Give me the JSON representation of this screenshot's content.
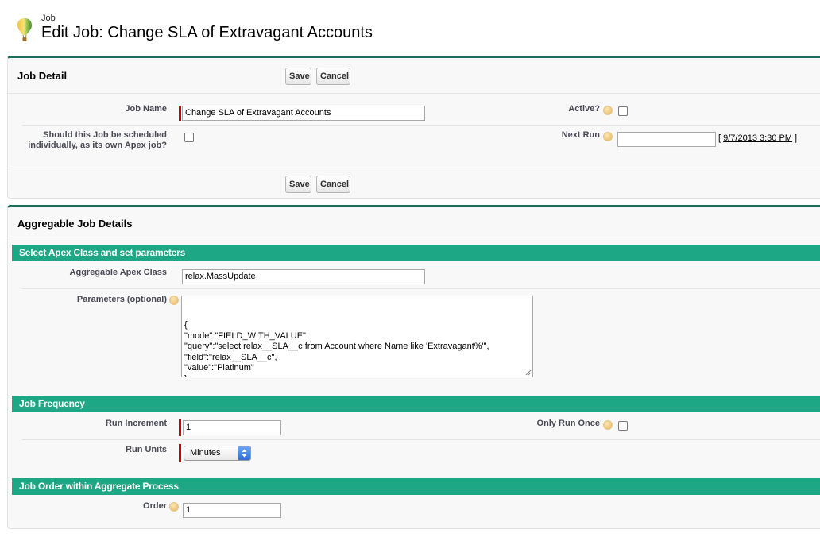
{
  "header": {
    "object_type": "Job",
    "title": "Edit Job: Change SLA of Extravagant Accounts",
    "icon": "hot-air-balloon-icon"
  },
  "job_detail": {
    "title": "Job Detail",
    "save_label": "Save",
    "cancel_label": "Cancel",
    "fields": {
      "job_name_label": "Job Name",
      "job_name_value": "Change SLA of Extravagant Accounts",
      "active_label": "Active?",
      "active_checked": false,
      "schedule_label_line1": "Should this Job be scheduled",
      "schedule_label_line2": "individually, as its own Apex job?",
      "schedule_checked": false,
      "next_run_label": "Next Run",
      "next_run_value": "",
      "next_run_open": "[ ",
      "next_run_date": "9/7/2013 3:30 PM",
      "next_run_close": " ]"
    }
  },
  "aggregable": {
    "title": "Aggregable Job Details",
    "apex_section": {
      "title": "Select Apex Class and set parameters",
      "class_label": "Aggregable Apex Class",
      "class_value": "relax.MassUpdate",
      "params_label": "Parameters (optional)",
      "params_value": "{\n\"mode\":\"FIELD_WITH_VALUE\",\n\"query\":\"select relax__SLA__c from Account where Name like 'Extravagant%'\",\n\"field\":\"relax__SLA__c\",\n\"value\":\"Platinum\"\n}"
    },
    "frequency_section": {
      "title": "Job Frequency",
      "run_increment_label": "Run Increment",
      "run_increment_value": "1",
      "only_run_once_label": "Only Run Once",
      "only_run_once_checked": false,
      "run_units_label": "Run Units",
      "run_units_value": "Minutes"
    },
    "order_section": {
      "title": "Job Order within Aggregate Process",
      "order_label": "Order",
      "order_value": "1"
    }
  },
  "colors": {
    "section_bar": "#1ea784",
    "panel_border": "#1c6f5b",
    "required_bar": "#cc0000"
  }
}
